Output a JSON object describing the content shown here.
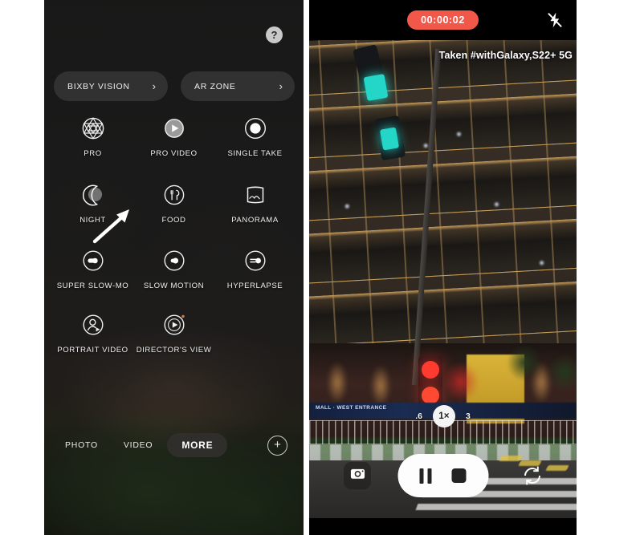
{
  "left_phone": {
    "help_label": "?",
    "shortcuts": [
      {
        "label": "BIXBY VISION",
        "chevron": "›"
      },
      {
        "label": "AR ZONE",
        "chevron": "›"
      }
    ],
    "modes": [
      {
        "label": "PRO",
        "icon": "aperture-icon"
      },
      {
        "label": "PRO VIDEO",
        "icon": "pro-video-icon"
      },
      {
        "label": "SINGLE TAKE",
        "icon": "single-take-icon"
      },
      {
        "label": "NIGHT",
        "icon": "moon-icon"
      },
      {
        "label": "FOOD",
        "icon": "food-icon"
      },
      {
        "label": "PANORAMA",
        "icon": "panorama-icon"
      },
      {
        "label": "SUPER SLOW-MO",
        "icon": "super-slow-mo-icon"
      },
      {
        "label": "SLOW MOTION",
        "icon": "slow-motion-icon"
      },
      {
        "label": "HYPERLAPSE",
        "icon": "hyperlapse-icon"
      },
      {
        "label": "PORTRAIT VIDEO",
        "icon": "portrait-video-icon"
      },
      {
        "label": "DIRECTOR'S VIEW",
        "icon": "directors-view-icon"
      }
    ],
    "tabs": [
      {
        "label": "PHOTO",
        "active": false
      },
      {
        "label": "VIDEO",
        "active": false
      },
      {
        "label": "MORE",
        "active": true
      }
    ],
    "add_button_label": "+"
  },
  "right_phone": {
    "recording_time": "00:00:02",
    "flash_icon": "flash-off-icon",
    "watermark": "Taken #withGalaxy,S22+ 5G",
    "zoom_levels": [
      {
        "label": ".6",
        "active": false
      },
      {
        "label": "1×",
        "active": true
      },
      {
        "label": "3",
        "active": false
      }
    ],
    "controls": {
      "thumbnail_icon": "camera-capture-icon",
      "pause_icon": "pause-icon",
      "stop_icon": "stop-icon",
      "switch_icon": "switch-camera-icon"
    },
    "scene_sign_text": "MALL · WEST ENTRANCE"
  },
  "colors": {
    "record_red": "#f2584a",
    "panel_dark": "#1c1a18",
    "accent_white": "#ffffff"
  }
}
